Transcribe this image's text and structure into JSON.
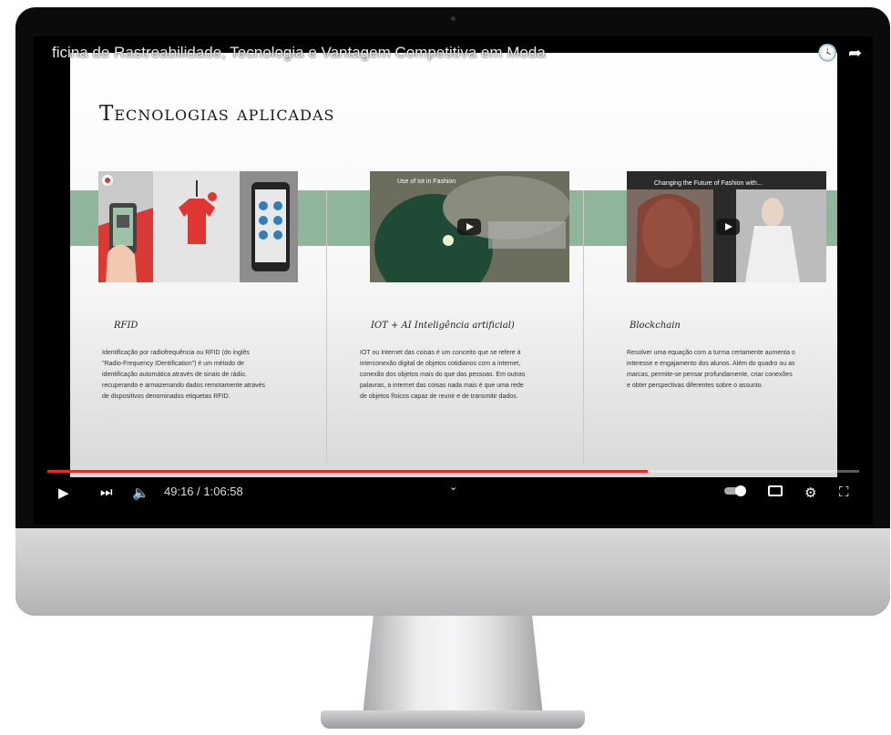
{
  "video": {
    "title": "ficina de Rastreabilidade, Tecnologia e Vantagem Competitiva em Moda",
    "time": "49:16 / 1:06:58",
    "progress": 0.74
  },
  "slide": {
    "title": "Tecnologias aplicadas",
    "columns": [
      {
        "heading": "RFID",
        "body": "Identificação por radiofrequência ou RFID (do inglês \"Radio-Frequency IDentification\") é um método de identificação automática através de sinais de rádio, recuperando e armazenando dados remotamente através de dispositivos denominados etiquetas RFID."
      },
      {
        "heading": "IOT + AI Inteligência artificial)",
        "body": "IOT ou Internet das coisas é um conceito que se refere à interconexão digital de objetos cotidianos com a internet, conexão dos objetos mais do que das pessoas. Em outras palavras, a internet das coisas nada mais é que uma rede de objetos físicos capaz de reunir e de transmitir dados."
      },
      {
        "heading": "Blockchain",
        "body": "Resolver uma equação com a turma certamente aumenta o interesse e engajamento dos alunos. Além do quadro ou as marcas, permite-se pensar profundamente, criar conexões e obter perspectivas diferentes sobre o assunto."
      }
    ],
    "thumb2_title": "Use of Iot in Fashion",
    "thumb3_title": "Changing the Future of Fashion with..."
  },
  "icons": {
    "play": "play-icon",
    "next": "skip-next-icon",
    "volume": "volume-icon",
    "clock": "watch-later-icon",
    "share": "share-icon",
    "autoplay": "autoplay-toggle-icon",
    "subtitles": "subtitles-icon",
    "settings": "settings-gear-icon",
    "fullscreen": "fullscreen-icon",
    "chevron": "chevron-down-icon"
  },
  "colors": {
    "accent": "#e52d27",
    "green_band": "#8fb59b"
  }
}
